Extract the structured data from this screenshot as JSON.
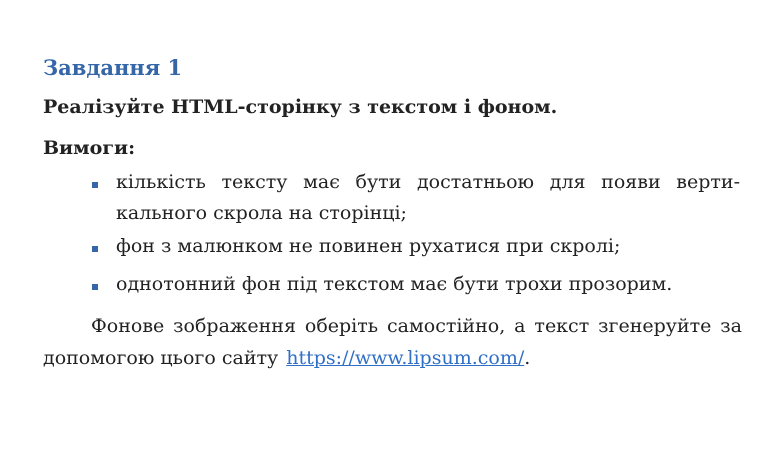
{
  "task": {
    "title": "Завдання 1",
    "statement": "Реалізуйте HTML-сторінку з текстом і фоном."
  },
  "requirements": {
    "heading": "Вимоги:",
    "items": [
      {
        "line1": "кількість тексту має бути достатньою для появи верти-",
        "line2": "кального скрола на сторінці;"
      },
      {
        "line1": "фон з малюнком не повинен рухатися при скролі;"
      },
      {
        "line1": "однотонний фон під текстом має бути трохи прозорим."
      }
    ]
  },
  "note": {
    "line1": "Фонове зображення оберіть самостійно, а текст згенеруйте за",
    "line2_prefix": "допомогою цього сайту",
    "link_text": "https://www.lipsum.com/",
    "suffix": "."
  },
  "colors": {
    "title": "#3566a8",
    "bullet": "#3566a8",
    "link": "#2f6fc6",
    "text": "#222222"
  }
}
